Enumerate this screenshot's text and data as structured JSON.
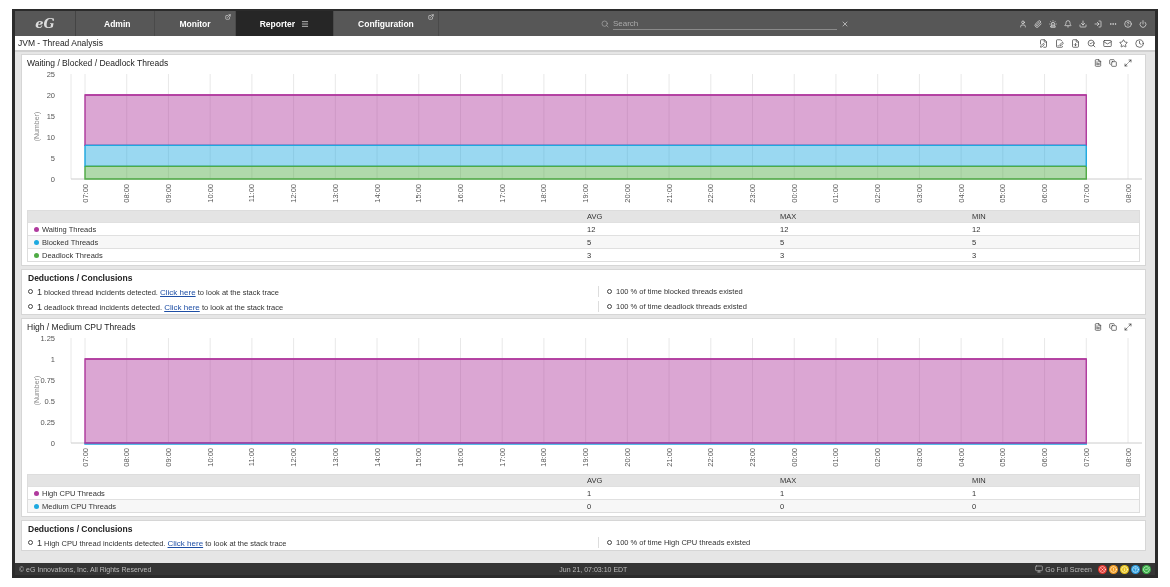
{
  "nav": {
    "logo": "eG",
    "tabs": [
      {
        "label": "Admin",
        "selected": false,
        "external": false,
        "menu": false
      },
      {
        "label": "Monitor",
        "selected": false,
        "external": true,
        "menu": false
      },
      {
        "label": "Reporter",
        "selected": true,
        "external": false,
        "menu": true
      },
      {
        "label": "Configuration",
        "selected": false,
        "external": true,
        "menu": false
      }
    ],
    "search": {
      "placeholder": "Search"
    }
  },
  "page": {
    "title": "JVM - Thread Analysis"
  },
  "sections": [
    {
      "title": "Waiting / Blocked / Deadlock Threads",
      "chart_data": {
        "type": "area",
        "stacked": true,
        "grid": true,
        "ylabel": "(Number)",
        "categories": [
          "07:00",
          "08:00",
          "09:00",
          "10:00",
          "11:00",
          "12:00",
          "13:00",
          "14:00",
          "15:00",
          "16:00",
          "17:00",
          "18:00",
          "19:00",
          "20:00",
          "21:00",
          "22:00",
          "23:00",
          "00:00",
          "01:00",
          "02:00",
          "03:00",
          "04:00",
          "05:00",
          "06:00",
          "07:00",
          "08:00"
        ],
        "ylim": [
          0,
          25
        ],
        "yticks": [
          0,
          5,
          10,
          15,
          20,
          25
        ],
        "series": [
          {
            "name": "Waiting Threads",
            "color": "#b03a9e",
            "values": [
              12,
              12,
              12,
              12,
              12,
              12,
              12,
              12,
              12,
              12,
              12,
              12,
              12,
              12,
              12,
              12,
              12,
              12,
              12,
              12,
              12,
              12,
              12,
              12,
              12,
              null
            ]
          },
          {
            "name": "Blocked Threads",
            "color": "#1ea9e0",
            "values": [
              5,
              5,
              5,
              5,
              5,
              5,
              5,
              5,
              5,
              5,
              5,
              5,
              5,
              5,
              5,
              5,
              5,
              5,
              5,
              5,
              5,
              5,
              5,
              5,
              5,
              null
            ]
          },
          {
            "name": "Deadlock Threads",
            "color": "#4fab45",
            "values": [
              3,
              3,
              3,
              3,
              3,
              3,
              3,
              3,
              3,
              3,
              3,
              3,
              3,
              3,
              3,
              3,
              3,
              3,
              3,
              3,
              3,
              3,
              3,
              3,
              3,
              null
            ]
          }
        ]
      },
      "summary": {
        "columns": [
          "AVG",
          "MAX",
          "MIN"
        ],
        "rows": [
          {
            "cells": [
              "12",
              "12",
              "12"
            ]
          },
          {
            "cells": [
              "5",
              "5",
              "5"
            ]
          },
          {
            "cells": [
              "3",
              "3",
              "3"
            ]
          }
        ]
      },
      "deductions": {
        "title": "Deductions / Conclusions",
        "items": [
          {
            "count": "1",
            "before": "blocked thread incidents detected.",
            "link": "Click here",
            "after": "to look at the stack trace",
            "stat": "100 % of time blocked threads existed"
          },
          {
            "count": "1",
            "before": "deadlock thread incidents detected.",
            "link": "Click here",
            "after": "to look at the stack trace",
            "stat": "100 % of time deadlock threads existed"
          }
        ]
      }
    },
    {
      "title": "High / Medium CPU Threads",
      "chart_data": {
        "type": "area",
        "stacked": false,
        "grid": true,
        "ylabel": "(Number)",
        "categories": [
          "07:00",
          "08:00",
          "09:00",
          "10:00",
          "11:00",
          "12:00",
          "13:00",
          "14:00",
          "15:00",
          "16:00",
          "17:00",
          "18:00",
          "19:00",
          "20:00",
          "21:00",
          "22:00",
          "23:00",
          "00:00",
          "01:00",
          "02:00",
          "03:00",
          "04:00",
          "05:00",
          "06:00",
          "07:00",
          "08:00"
        ],
        "ylim": [
          0,
          1.25
        ],
        "yticks": [
          0,
          0.25,
          0.5,
          0.75,
          1,
          1.25
        ],
        "series": [
          {
            "name": "High CPU Threads",
            "color": "#b03a9e",
            "values": [
              1,
              1,
              1,
              1,
              1,
              1,
              1,
              1,
              1,
              1,
              1,
              1,
              1,
              1,
              1,
              1,
              1,
              1,
              1,
              1,
              1,
              1,
              1,
              1,
              1,
              null
            ]
          },
          {
            "name": "Medium CPU Threads",
            "color": "#1ea9e0",
            "values": [
              0,
              0,
              0,
              0,
              0,
              0,
              0,
              0,
              0,
              0,
              0,
              0,
              0,
              0,
              0,
              0,
              0,
              0,
              0,
              0,
              0,
              0,
              0,
              0,
              0,
              null
            ]
          }
        ]
      },
      "summary": {
        "columns": [
          "AVG",
          "MAX",
          "MIN"
        ],
        "rows": [
          {
            "cells": [
              "1",
              "1",
              "1"
            ]
          },
          {
            "cells": [
              "0",
              "0",
              "0"
            ]
          }
        ]
      },
      "deductions": {
        "title": "Deductions / Conclusions",
        "items": [
          {
            "count": "1",
            "before": "High CPU thread incidents detected.",
            "link": "Click here",
            "after": "to look at the stack trace",
            "stat": "100 % of time High CPU threads existed"
          }
        ]
      }
    }
  ],
  "footer": {
    "copyright": "© eG Innovations, Inc. All Rights Reserved",
    "time": "Jun 21, 07:03:10 EDT",
    "fullscreen": "Go Full Screen"
  }
}
